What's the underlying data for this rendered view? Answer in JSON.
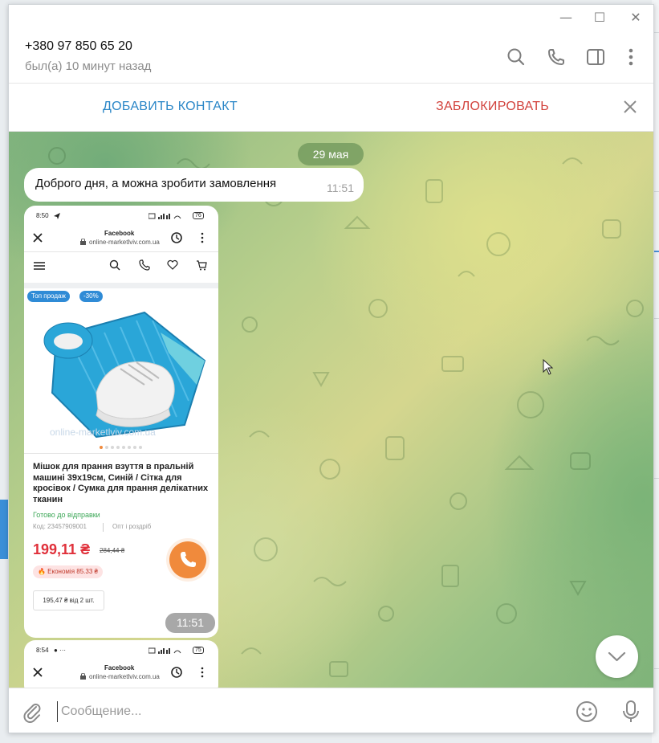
{
  "window": {
    "controls": {
      "minimize": "—",
      "maximize": "☐",
      "close": "✕"
    }
  },
  "header": {
    "contact_name": "+380 97 850 65 20",
    "status": "был(а) 10 минут назад",
    "icons": [
      "search-icon",
      "phone-icon",
      "sidebar-toggle-icon",
      "more-vertical-icon"
    ]
  },
  "actionbar": {
    "add_contact": "ДОБАВИТЬ КОНТАКТ",
    "block": "ЗАБЛОКИРОВАТЬ"
  },
  "chat": {
    "date": "29 мая",
    "messages": [
      {
        "text": "Доброго дня, а можна зробити замовлення",
        "time": "11:51"
      }
    ],
    "screenshot_message": {
      "time": "11:51",
      "phone": {
        "status_time": "8:50",
        "battery": "76",
        "browser_title": "Facebook",
        "browser_url": "online-marketlviv.com.ua",
        "tags": [
          "Топ продаж",
          "-30%"
        ],
        "watermark": "online-marketlviv.com.ua",
        "product_title": "Мішок для прання взуття в пральній машині 39х19см, Синій / Сітка для кросівок / Сумка для прання делікатних тканин",
        "availability": "Готово до відправки",
        "code": "Код: 23457909001",
        "sale_type": "Опт і роздріб",
        "price": "199,11 ₴",
        "old_price": "284,44 ₴",
        "economy": "🔥 Економія 85.33 ₴",
        "bulk_price": "195,47 ₴ від 2 шт."
      }
    },
    "second_screenshot": {
      "status_time": "8:54",
      "battery": "75",
      "browser_title": "Facebook",
      "browser_url": "online-marketlviv.com.ua"
    }
  },
  "composer": {
    "placeholder": "Сообщение..."
  },
  "colors": {
    "accent_blue": "#2a86c7",
    "block_red": "#d2423c",
    "price_red": "#e0313b",
    "call_orange": "#f08a3c"
  }
}
